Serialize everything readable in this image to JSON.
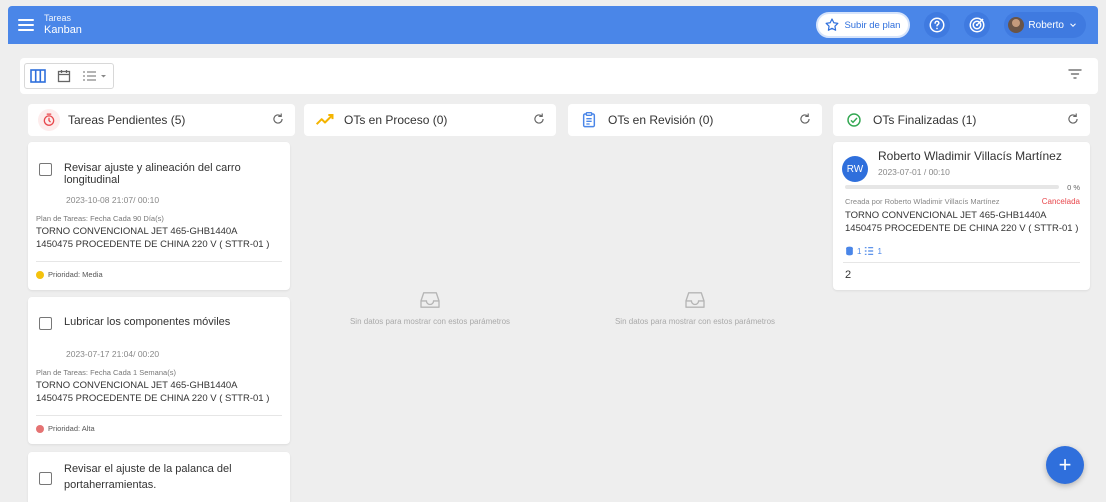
{
  "header": {
    "section": "Tareas",
    "view": "Kanban",
    "upgrade_label": "Subir de plan",
    "user_name": "Roberto"
  },
  "columns": [
    {
      "title": "Tareas Pendientes (5)",
      "icon": "timer-icon",
      "color": "#e8474c"
    },
    {
      "title": "OTs en Proceso (0)",
      "icon": "trend-icon",
      "color": "#f4b400"
    },
    {
      "title": "OTs en Revisión (0)",
      "icon": "clipboard-icon",
      "color": "#4a86e8"
    },
    {
      "title": "OTs Finalizadas (1)",
      "icon": "check-circle-icon",
      "color": "#34a853"
    }
  ],
  "pending_tasks": [
    {
      "title": "Revisar ajuste y alineación del carro longitudinal",
      "date": "2023-10-08 21:07/ 00:10",
      "plan": "Plan de Tareas: Fecha Cada 90 Día(s)",
      "machine_line1": "TORNO CONVENCIONAL JET 465-GHB1440A",
      "machine_line2": "1450475 PROCEDENTE DE CHINA 220 V ( STTR-01 )",
      "priority": "Prioridad: Media",
      "priority_color": "#f4c20d"
    },
    {
      "title": "Lubricar los componentes móviles",
      "date": "2023-07-17 21:04/ 00:20",
      "plan": "Plan de Tareas: Fecha Cada 1 Semana(s)",
      "machine_line1": "TORNO CONVENCIONAL JET 465-GHB1440A",
      "machine_line2": "1450475 PROCEDENTE DE CHINA 220 V ( STTR-01 )",
      "priority": "Prioridad: Alta",
      "priority_color": "#e57373"
    },
    {
      "title_line1": "Revisar el ajuste de la palanca del",
      "title_line2": "portaherramientas."
    }
  ],
  "empty_message": "Sin datos para mostrar con estos parámetros",
  "finished_ot": {
    "initials": "RW",
    "name": "Roberto Wladimir Villacís Martínez",
    "date": "2023-07-01 / 00:10",
    "progress_percent": 0,
    "progress_label": "0 %",
    "created_by": "Creada por Roberto Wladimir Villacís Martínez",
    "status": "Cancelada",
    "machine_line1": "TORNO CONVENCIONAL JET 465-GHB1440A",
    "machine_line2": "1450475 PROCEDENTE DE CHINA 220 V ( STTR-01 )",
    "resources_count": "1",
    "tasks_count": "1",
    "number": "2"
  },
  "fab_label": "+"
}
